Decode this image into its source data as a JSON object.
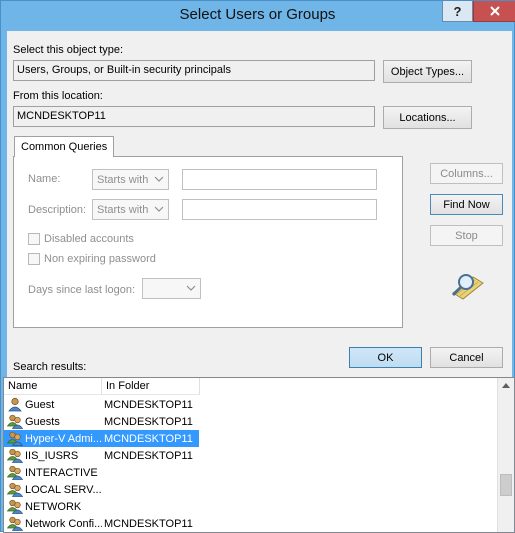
{
  "window": {
    "title": "Select Users or Groups",
    "help_label": "?",
    "close_label": "X"
  },
  "object_type": {
    "label": "Select this object type:",
    "value": "Users, Groups, or Built-in security principals",
    "button": "Object Types..."
  },
  "location": {
    "label": "From this location:",
    "value": "MCNDESKTOP11",
    "button": "Locations..."
  },
  "tab": {
    "label": "Common Queries"
  },
  "queries": {
    "name_label": "Name:",
    "name_mode": "Starts with",
    "name_value": "",
    "description_label": "Description:",
    "description_mode": "Starts with",
    "description_value": "",
    "disabled_accounts": "Disabled accounts",
    "non_expiring": "Non expiring password",
    "days_label": "Days since last logon:",
    "days_value": ""
  },
  "side_buttons": {
    "columns": "Columns...",
    "find_now": "Find Now",
    "stop": "Stop"
  },
  "actions": {
    "ok": "OK",
    "cancel": "Cancel"
  },
  "results": {
    "label": "Search results:",
    "columns": [
      "Name",
      "In Folder"
    ],
    "rows": [
      {
        "name": "Guest",
        "folder": "MCNDESKTOP11",
        "icon": "user-icon"
      },
      {
        "name": "Guests",
        "folder": "MCNDESKTOP11",
        "icon": "group-icon"
      },
      {
        "name": "Hyper-V Admi...",
        "folder": "MCNDESKTOP11",
        "icon": "group-icon",
        "selected": true
      },
      {
        "name": "IIS_IUSRS",
        "folder": "MCNDESKTOP11",
        "icon": "group-icon"
      },
      {
        "name": "INTERACTIVE",
        "folder": "",
        "icon": "group-icon"
      },
      {
        "name": "LOCAL SERV...",
        "folder": "",
        "icon": "group-icon"
      },
      {
        "name": "NETWORK",
        "folder": "",
        "icon": "group-icon"
      },
      {
        "name": "Network Confi...",
        "folder": "MCNDESKTOP11",
        "icon": "group-icon"
      }
    ]
  },
  "colors": {
    "title_bar": "#6fb5e8",
    "selection": "#3399ff",
    "close": "#c75050"
  }
}
